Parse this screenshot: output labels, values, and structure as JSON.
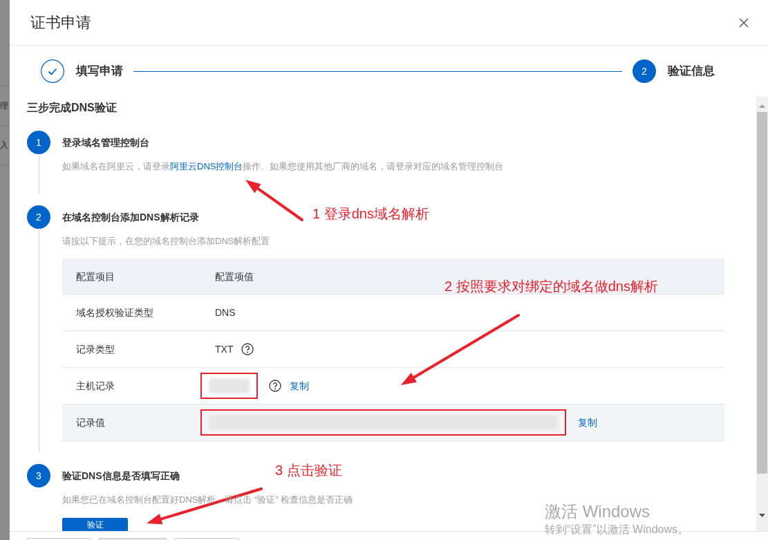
{
  "backdrop": {
    "fragments": [
      "理",
      "入"
    ]
  },
  "dialog": {
    "title": "证书申请"
  },
  "progress": [
    {
      "kind": "done",
      "label": "填写申请"
    },
    {
      "kind": "current",
      "number": "2",
      "label": "验证信息"
    }
  ],
  "section_title": "三步完成DNS验证",
  "guide": [
    {
      "number": "1",
      "title": "登录域名管理控制台",
      "description": [
        {
          "text": "如果域名在阿里云，请登录"
        },
        {
          "text": "阿里云DNS控制台",
          "link": true
        },
        {
          "text": "操作。如果您使用其他厂商的域名，请登录对应的域名管理控制台"
        }
      ]
    },
    {
      "number": "2",
      "title": "在域名控制台添加DNS解析记录",
      "description": [
        {
          "text": "请按以下提示，在您的域名控制台添加DNS解析配置"
        }
      ],
      "table": {
        "columns": [
          "配置项目",
          "配置项值"
        ],
        "rows": [
          {
            "item": "域名授权验证类型",
            "kind": "text",
            "value": "DNS",
            "help": false,
            "hovered": false
          },
          {
            "item": "记录类型",
            "kind": "text",
            "value": "TXT",
            "help": true,
            "hovered": false
          },
          {
            "item": "主机记录",
            "kind": "redacted",
            "help": true,
            "copy": "复制",
            "highlighted": true,
            "hovered": false
          },
          {
            "item": "记录值",
            "kind": "redacted",
            "help": false,
            "copy": "复制",
            "highlighted": true,
            "hovered": true
          }
        ]
      }
    },
    {
      "number": "3",
      "title": "验证DNS信息是否填写正确",
      "description": [
        {
          "text": "如果您已在域名控制台配置好DNS解析，请点击 “验证” 检查信息是否正确"
        }
      ],
      "button": "验证"
    }
  ],
  "annotations": [
    {
      "text": "1 登录dns域名解析"
    },
    {
      "text": "2 按照要求对绑定的域名做dns解析"
    },
    {
      "text": "3 点击验证"
    }
  ],
  "os_notice": {
    "title": "激活 Windows",
    "subtitle": "转到“设置”以激活 Windows。"
  }
}
